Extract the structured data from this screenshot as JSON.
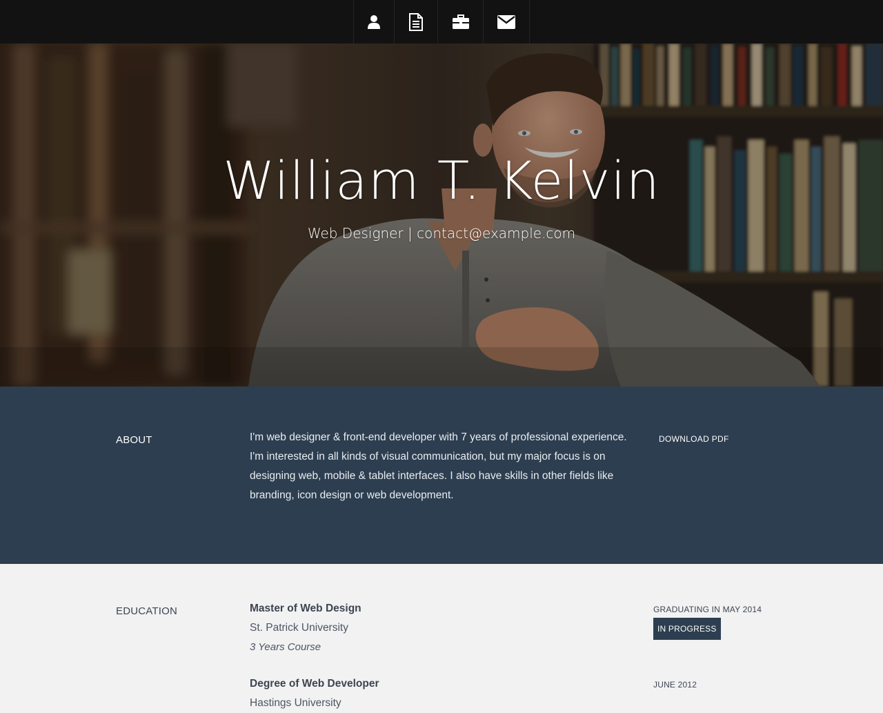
{
  "nav": {
    "items": [
      {
        "icon": "user-icon"
      },
      {
        "icon": "document-icon"
      },
      {
        "icon": "briefcase-icon"
      },
      {
        "icon": "envelope-icon"
      }
    ]
  },
  "hero": {
    "name": "William T. Kelvin",
    "subtitle": "Web Designer | contact@example.com"
  },
  "about": {
    "label": "About",
    "text": "I'm web designer & front-end developer with 7 years of professional experience. I'm interested in all kinds of visual communication, but my major focus is on designing web, mobile & tablet interfaces. I also have skills in other fields like branding, icon design or web development.",
    "download_label": "Download PDF"
  },
  "education": {
    "label": "Education",
    "entries": [
      {
        "title": "Master of Web Design",
        "school": "St. Patrick University",
        "course": "3 Years Course",
        "date": "Graduating in May 2014",
        "badge": "In Progress"
      },
      {
        "title": "Degree of Web Developer",
        "school": "Hastings University",
        "date": "June 2012"
      }
    ]
  },
  "colors": {
    "nav_bg": "#121212",
    "about_bg": "#2d3e50",
    "page_bg": "#f2f2f2",
    "badge_bg": "#2d3e50"
  }
}
